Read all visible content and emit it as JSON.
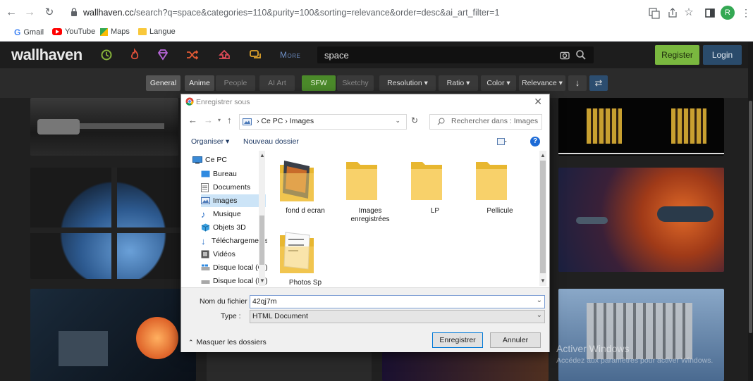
{
  "browser": {
    "url_host": "wallhaven.cc",
    "url_rest": "/search?q=space&categories=110&purity=100&sorting=relevance&order=desc&ai_art_filter=1",
    "profile_initial": "R",
    "bookmarks": [
      "Gmail",
      "YouTube",
      "Maps",
      "Langue"
    ]
  },
  "site": {
    "logo": "wallhaven",
    "more_label": "More",
    "search_value": "space",
    "register_label": "Register",
    "login_label": "Login",
    "filters": [
      "General",
      "Anime",
      "People",
      "AI Art",
      "SFW",
      "Sketchy",
      "Resolution ▾",
      "Ratio ▾",
      "Color ▾",
      "Relevance ▾"
    ]
  },
  "dialog": {
    "title": "Enregistrer sous",
    "path": [
      "Ce PC",
      "Images"
    ],
    "search_placeholder": "Rechercher dans : Images",
    "organize_label": "Organiser ▾",
    "new_folder_label": "Nouveau dossier",
    "nav_items": [
      "Ce PC",
      "Bureau",
      "Documents",
      "Images",
      "Musique",
      "Objets 3D",
      "Téléchargements",
      "Vidéos",
      "Disque local (C:)",
      "Disque local (D:)"
    ],
    "selected_nav": "Images",
    "files": [
      "fond d ecran",
      "Images enregistrées",
      "LP",
      "Pellicule",
      "Photos Sp"
    ],
    "filename_label": "Nom du fichier :",
    "filename_value": "42qj7m",
    "type_label": "Type :",
    "type_value": "HTML Document",
    "hide_folders_label": "Masquer les dossiers",
    "save_label": "Enregistrer",
    "cancel_label": "Annuler"
  },
  "os": {
    "watermark_title": "Activer Windows",
    "watermark_sub": "Accédez aux paramètres pour activer Windows."
  }
}
